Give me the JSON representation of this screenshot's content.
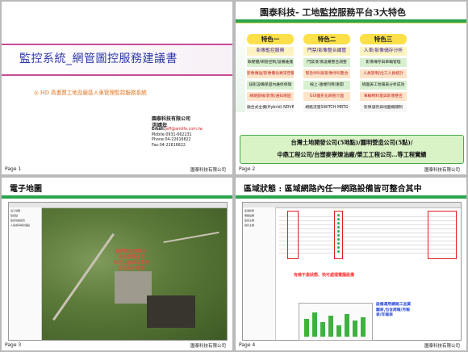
{
  "slides": [
    {
      "page": "Page 1",
      "footer_company": "園泰科技有限公司",
      "title": "監控系統_網管圖控服務建議書",
      "subtitle": "◎ HD 高畫質工地及廠區人車管理監控服務系統",
      "contact": {
        "company": "園泰科技有限公司",
        "name": "洪靖年",
        "email_label": "Email:",
        "email": "jeff@amlife.com.tw",
        "mobile": "Mobile:0931-662231",
        "phone": "Phone:04-22616822",
        "fax": "Fax:04-22616822"
      }
    },
    {
      "page": "Page 2",
      "footer_company": "園泰科技有限公司",
      "heading": "園泰科技- 工地監控服務平台3大特色",
      "columns": [
        {
          "header": "特色一",
          "sub": "影像監控服務",
          "items": [
            "軟硬體/網管控制/設備維護",
            "影像傳送/影像備份異常告警",
            "錄影設備保固內維修保障",
            "網路斷線/影像/通知保固",
            "融合式主機(Hybrid) NDVR"
          ]
        },
        {
          "header": "特色二",
          "sub": "門禁/影像整合續管",
          "items": [
            "門禁/影像設備整合調整",
            "緊急呼叫與影像呼叫整合",
            "線上-遠端列用/重開",
            "GUI圖形化網管介面",
            "網路流量SWITCH MRTG"
          ]
        },
        {
          "header": "特色三",
          "sub": "人車/影像儲存分析",
          "items": [
            "影像傳存與車輛管理",
            "人員管制/出工人員統計",
            "統圖表工地報表分析成效",
            "車輛物料量與影像整合",
            "影像儲存與地圖機關制"
          ]
        }
      ],
      "clients_line1": "台灣土地開發公司(5地點)/麗明營造公司(5點)/",
      "clients_line2": "中鼎工程公司/台塑麥寮煉油廠/榮工工程公司…等工程實績"
    },
    {
      "page": "Page 3",
      "footer_company": "園泰科技有限公司",
      "heading": "電子地圖",
      "nav_items": [
        "電子地圖",
        "監控點",
        "監控地點配置",
        "人員或車輛管理點"
      ],
      "annotation": [
        "攝影機狀態顯示:",
        "綠色狀態正常",
        "紅色狀態表示異常",
        "灰色表示暫停"
      ]
    },
    {
      "page": "Page 4",
      "footer_company": "園泰科技有限公司",
      "heading": "區域狀態 : 區域網路內任一網路設備皆可整合其中",
      "nav_items": [
        "區域狀態",
        "網路設備",
        "監控主機",
        "錄影主機"
      ],
      "tip1": "有條不紊狀態、快可處理電腦設備",
      "tip2": [
        "設備運用網路工品質",
        "圖表,包含周報/月報",
        "表/年報表"
      ]
    }
  ],
  "colors": {
    "accent_green": "#2da44e",
    "title_blue": "#2e3aa8",
    "feature_yellow": "#fbe04a",
    "alert_red": "#c21d1d"
  }
}
